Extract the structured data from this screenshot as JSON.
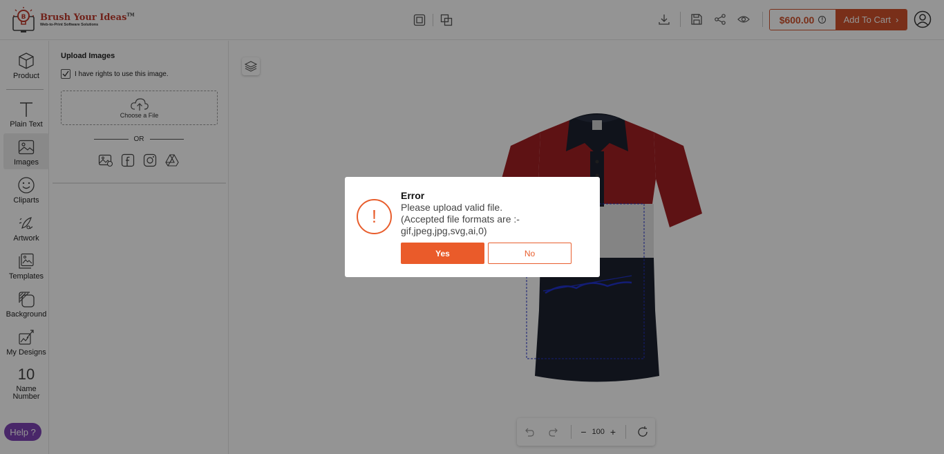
{
  "brand": {
    "name": "Brush Your Ideas",
    "tm": "TM",
    "tagline": "Web-to-Print Software Solutions"
  },
  "header": {
    "price": "$600.00",
    "price_info": "!",
    "add_to_cart": "Add To Cart",
    "cart_chevron": "›"
  },
  "sidebar": {
    "items": [
      {
        "label": "Product",
        "icon": "cube-icon"
      },
      {
        "label": "Plain Text",
        "icon": "text-icon"
      },
      {
        "label": "Images",
        "icon": "image-icon"
      },
      {
        "label": "Cliparts",
        "icon": "smiley-icon"
      },
      {
        "label": "Artwork",
        "icon": "artwork-icon"
      },
      {
        "label": "Templates",
        "icon": "templates-icon"
      },
      {
        "label": "Background",
        "icon": "background-icon"
      },
      {
        "label": "My Designs",
        "icon": "my-designs-icon"
      },
      {
        "label": "Name Number",
        "icon": "name-number-icon",
        "glyph": "10"
      }
    ],
    "help": "Help ?"
  },
  "upload_panel": {
    "title": "Upload Images",
    "rights_label": "I have rights to use this image.",
    "rights_checked": true,
    "choose_file": "Choose a File",
    "or": "OR",
    "sources": [
      "gallery-icon",
      "facebook-icon",
      "instagram-icon",
      "google-drive-icon"
    ]
  },
  "canvas": {
    "zoom": "100",
    "shirt_colors": {
      "upper": "#a31f24",
      "middle": "#e4e4e4",
      "lower": "#1c2230",
      "collar": "#1c2230"
    }
  },
  "dialog": {
    "title": "Error",
    "line1": "Please upload valid file.",
    "line2": "(Accepted file formats are :-",
    "line3": "gif,jpeg,jpg,svg,ai,0)",
    "icon": "!",
    "yes": "Yes",
    "no": "No"
  },
  "colors": {
    "accent": "#d1522c",
    "dialog_accent": "#ea5b2a",
    "help": "#7f44b6"
  }
}
